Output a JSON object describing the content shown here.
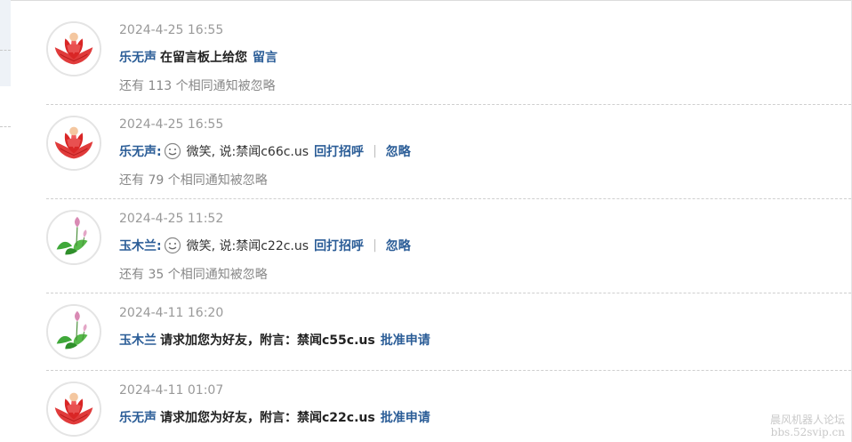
{
  "notifications": [
    {
      "time": "2024-4-25 16:55",
      "avatar": "lotus-red-icon",
      "user": "乐无声",
      "action": "在留言板上给您",
      "link": "留言",
      "ignored": "还有 113 个相同通知被忽略"
    },
    {
      "time": "2024-4-25 16:55",
      "avatar": "lotus-red-icon",
      "user": "乐无声:",
      "emoticon": "smile-face-icon",
      "message": "微笑, 说:禁闻c66c.us",
      "reply_link": "回打招呼",
      "separator": "|",
      "ignore_link": "忽略",
      "ignored": "还有 79 个相同通知被忽略"
    },
    {
      "time": "2024-4-25 11:52",
      "avatar": "lotus-green-icon",
      "user": "玉木兰:",
      "emoticon": "smile-face-icon",
      "message": "微笑, 说:禁闻c22c.us",
      "reply_link": "回打招呼",
      "separator": "|",
      "ignore_link": "忽略",
      "ignored": "还有 35 个相同通知被忽略"
    },
    {
      "time": "2024-4-11 16:20",
      "avatar": "lotus-green-icon",
      "user": "玉木兰",
      "action": "请求加您为好友，附言：禁闻c55c.us",
      "link": "批准申请"
    },
    {
      "time": "2024-4-11 01:07",
      "avatar": "lotus-red-icon",
      "user": "乐无声",
      "action": "请求加您为好友，附言：禁闻c22c.us",
      "link": "批准申请"
    }
  ],
  "watermark": {
    "line1": "晨风机器人论坛",
    "line2": "bbs.52svip.cn"
  },
  "colors": {
    "link": "#2b5d97",
    "muted": "#999999",
    "divider": "#cfcfcf"
  }
}
